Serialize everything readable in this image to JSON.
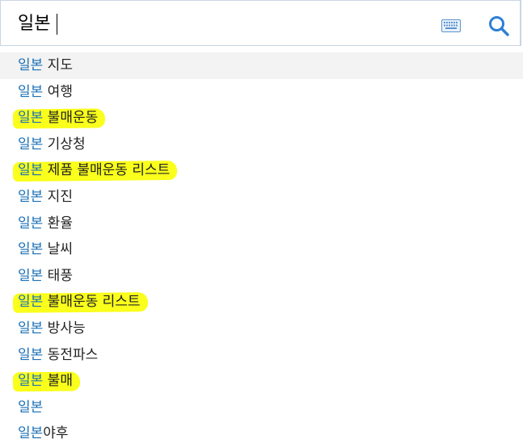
{
  "search": {
    "query": "일본"
  },
  "icons": {
    "keyboard": "keyboard-icon",
    "search": "search-icon"
  },
  "colors": {
    "match_text": "#1a6fb5",
    "highlight": "#faff1c",
    "active_row": "#f3f3f3"
  },
  "suggestions": [
    {
      "match": "일본",
      "rest": " 지도",
      "highlighted": false,
      "active": true
    },
    {
      "match": "일본",
      "rest": " 여행",
      "highlighted": false,
      "active": false
    },
    {
      "match": "일본",
      "rest": " 불매운동",
      "highlighted": true,
      "active": false
    },
    {
      "match": "일본",
      "rest": " 기상청",
      "highlighted": false,
      "active": false
    },
    {
      "match": "일본",
      "rest": " 제품 불매운동 리스트",
      "highlighted": true,
      "active": false
    },
    {
      "match": "일본",
      "rest": " 지진",
      "highlighted": false,
      "active": false
    },
    {
      "match": "일본",
      "rest": " 환율",
      "highlighted": false,
      "active": false
    },
    {
      "match": "일본",
      "rest": " 날씨",
      "highlighted": false,
      "active": false
    },
    {
      "match": "일본",
      "rest": " 태풍",
      "highlighted": false,
      "active": false
    },
    {
      "match": "일본",
      "rest": " 불매운동 리스트",
      "highlighted": true,
      "active": false
    },
    {
      "match": "일본",
      "rest": " 방사능",
      "highlighted": false,
      "active": false
    },
    {
      "match": "일본",
      "rest": " 동전파스",
      "highlighted": false,
      "active": false
    },
    {
      "match": "일본",
      "rest": " 불매",
      "highlighted": true,
      "active": false
    },
    {
      "match": "일본",
      "rest": "",
      "highlighted": false,
      "active": false
    },
    {
      "match": "일본",
      "rest": "야후",
      "highlighted": false,
      "active": false
    }
  ]
}
